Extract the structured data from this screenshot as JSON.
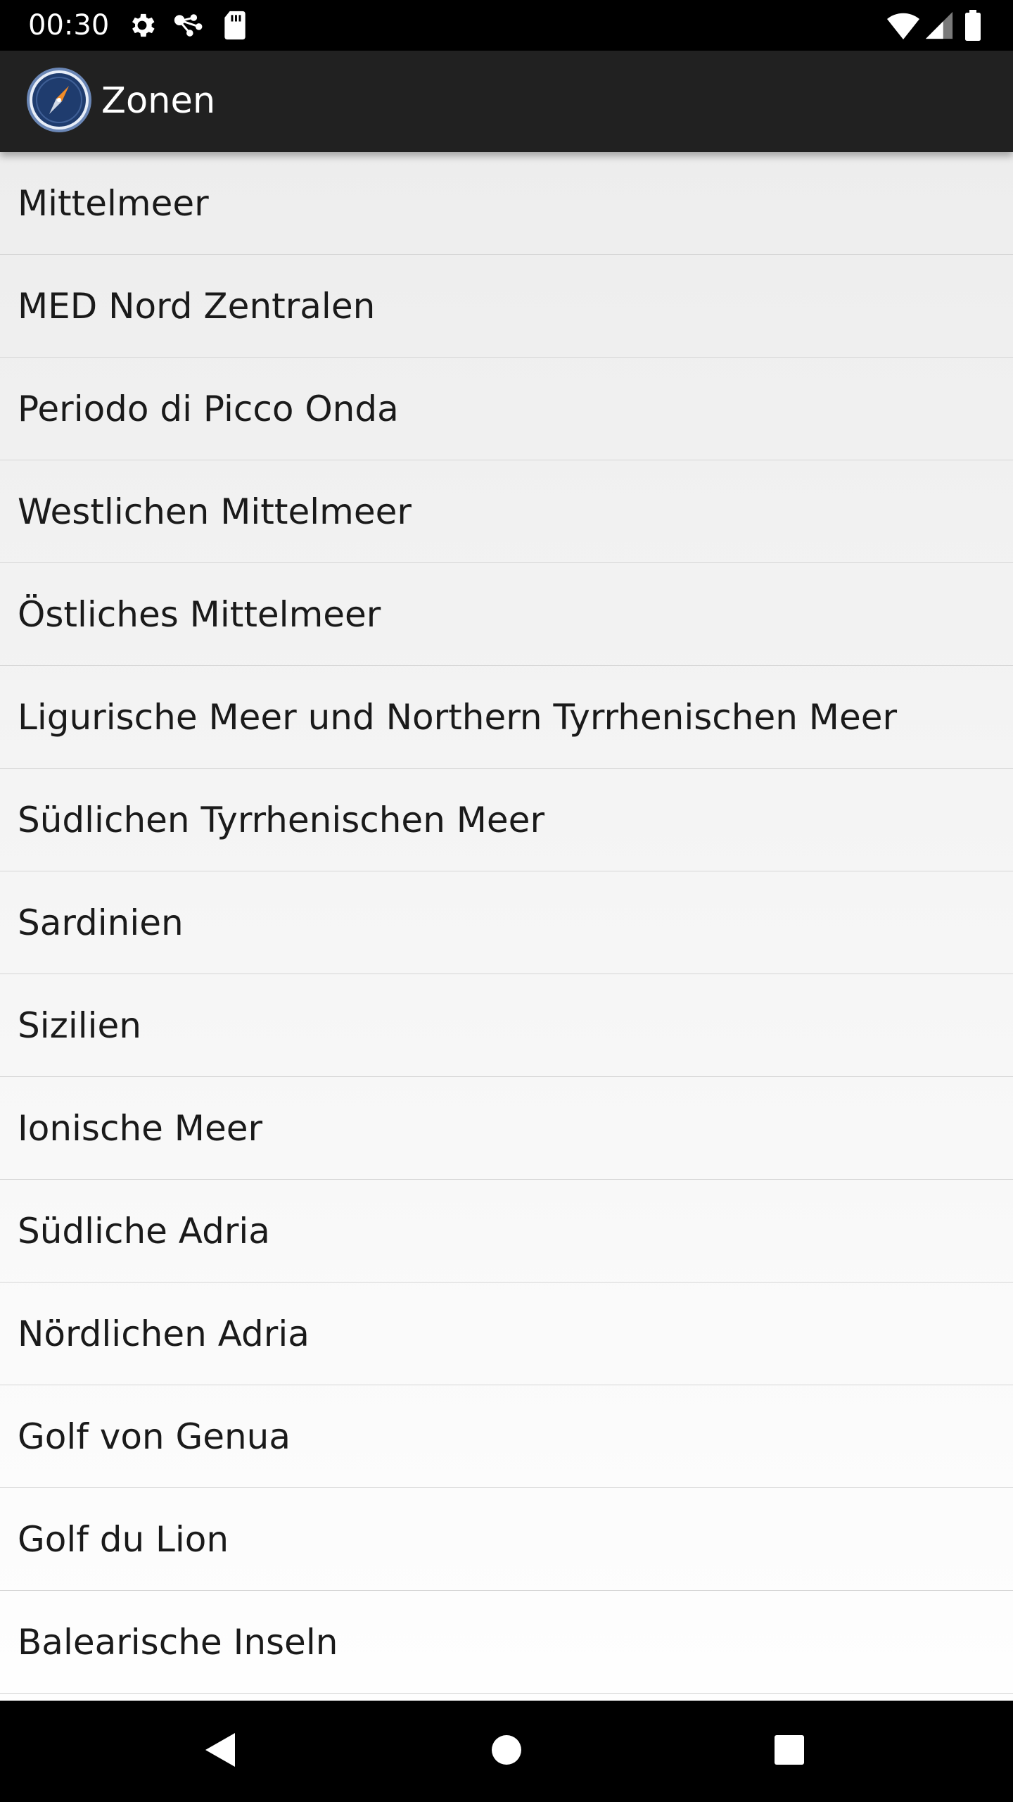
{
  "status_bar": {
    "time": "00:30",
    "icons": [
      "settings-icon",
      "network-share-icon",
      "sd-card-icon",
      "wifi-icon",
      "signal-icon",
      "battery-icon"
    ]
  },
  "app_bar": {
    "title": "Zonen",
    "logo": "compass-icon"
  },
  "zones": [
    "Mittelmeer",
    "MED Nord Zentralen",
    "Periodo di Picco Onda",
    "Westlichen Mittelmeer",
    "Östliches Mittelmeer",
    "Ligurische Meer und Northern Tyrrhenischen Meer",
    "Südlichen Tyrrhenischen Meer",
    "Sardinien",
    "Sizilien",
    "Ionische Meer",
    "Südliche Adria",
    "Nördlichen Adria",
    "Golf von Genua",
    "Golf du Lion",
    "Balearische Inseln"
  ],
  "nav_bar": {
    "buttons": [
      "back-icon",
      "home-icon",
      "recents-icon"
    ]
  },
  "colors": {
    "status_bar": "#000000",
    "app_bar": "#212121",
    "list_background": "#f2f2f2",
    "divider": "#d6d6d6",
    "text": "#1a1a1a",
    "compass_orange": "#f28c28",
    "compass_blue": "#1f3c6e"
  }
}
